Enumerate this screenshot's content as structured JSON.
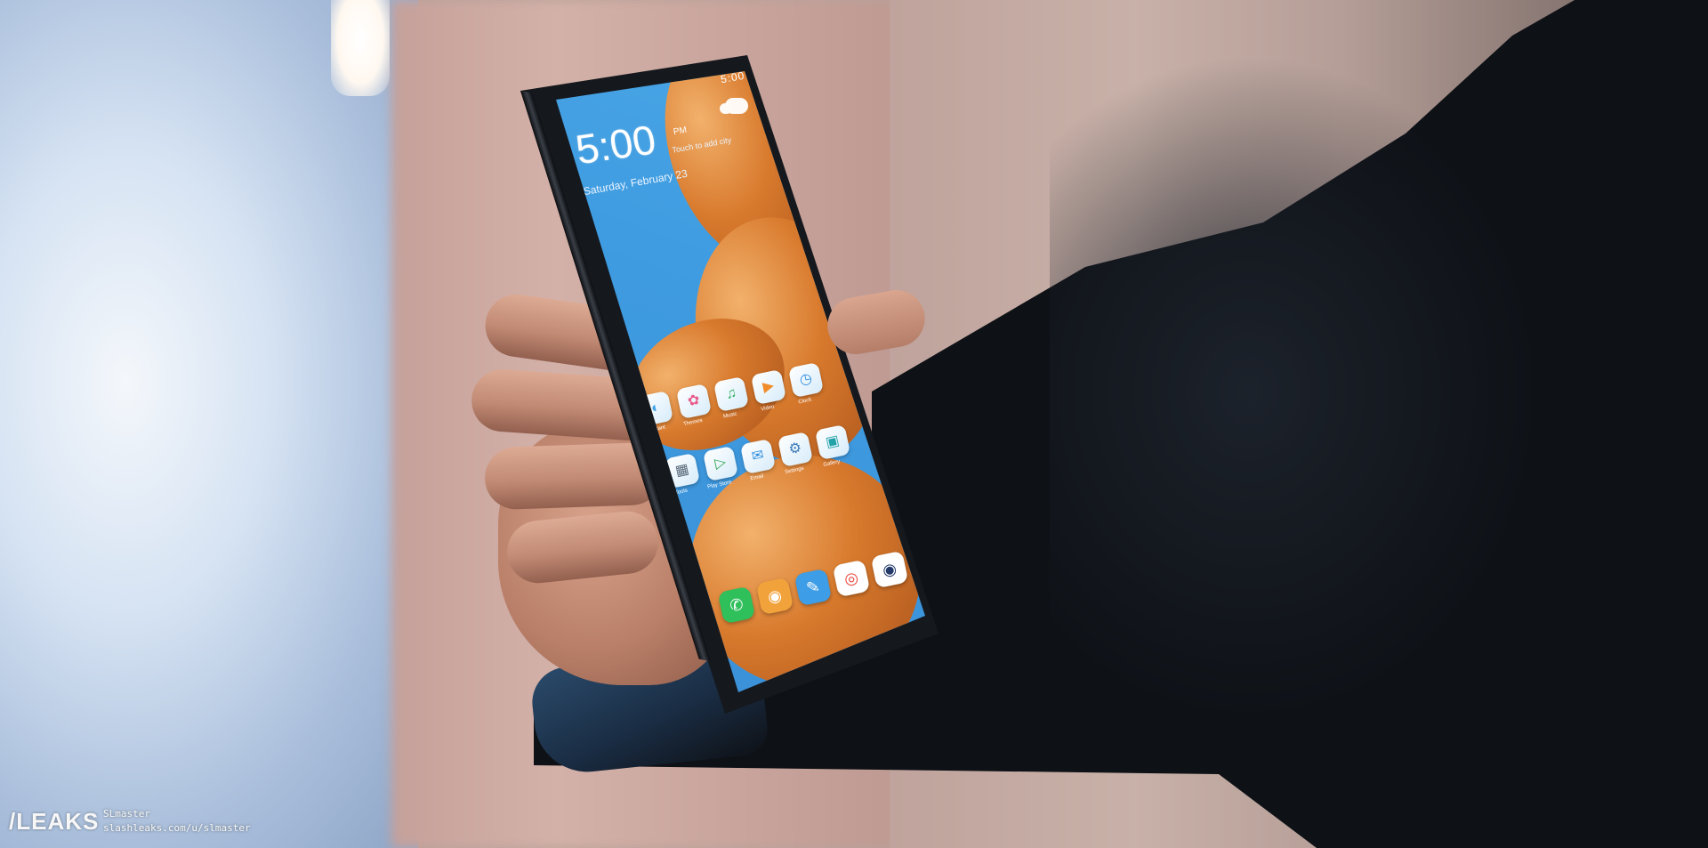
{
  "lockscreen": {
    "time": "5:00",
    "ampm": "PM",
    "hint": "Touch to add city",
    "date": "Saturday, February 23",
    "status": "5:00"
  },
  "apps": [
    {
      "label": "Assistant",
      "icon": "assistant-icon",
      "glyph": "◐",
      "color": "#41a4e8"
    },
    {
      "label": "Themes",
      "icon": "themes-icon",
      "glyph": "✿",
      "color": "#e85c8a"
    },
    {
      "label": "Music",
      "icon": "music-icon",
      "glyph": "♫",
      "color": "#36b06a"
    },
    {
      "label": "Video",
      "icon": "video-icon",
      "glyph": "▶",
      "color": "#f08c2b"
    },
    {
      "label": "Clock",
      "icon": "clock-icon",
      "glyph": "◷",
      "color": "#2f8ee0"
    },
    {
      "label": "Tools",
      "icon": "tools-icon",
      "glyph": "▦",
      "color": "#5a6a7a"
    },
    {
      "label": "Play Store",
      "icon": "play-store-icon",
      "glyph": "▷",
      "color": "#34a853"
    },
    {
      "label": "Email",
      "icon": "email-icon",
      "glyph": "✉",
      "color": "#2f8ee0"
    },
    {
      "label": "Settings",
      "icon": "settings-icon",
      "glyph": "⚙",
      "color": "#3c7bb8"
    },
    {
      "label": "Gallery",
      "icon": "gallery-icon",
      "glyph": "▣",
      "color": "#22a3a8"
    }
  ],
  "dock": [
    {
      "icon": "phone-icon",
      "glyph": "✆",
      "color": "#2fbf5b"
    },
    {
      "icon": "contacts-icon",
      "glyph": "◉",
      "color": "#f2a23a"
    },
    {
      "icon": "messages-icon",
      "glyph": "✎",
      "color": "#3d9de6"
    },
    {
      "icon": "chrome-icon",
      "glyph": "◎",
      "color": "#e8453c"
    },
    {
      "icon": "camera-icon",
      "glyph": "◉",
      "color": "#233a6a"
    }
  ],
  "watermark": {
    "logo": "/LEAKS",
    "author": "SLmaster",
    "url": "slashleaks.com/u/slmaster"
  }
}
